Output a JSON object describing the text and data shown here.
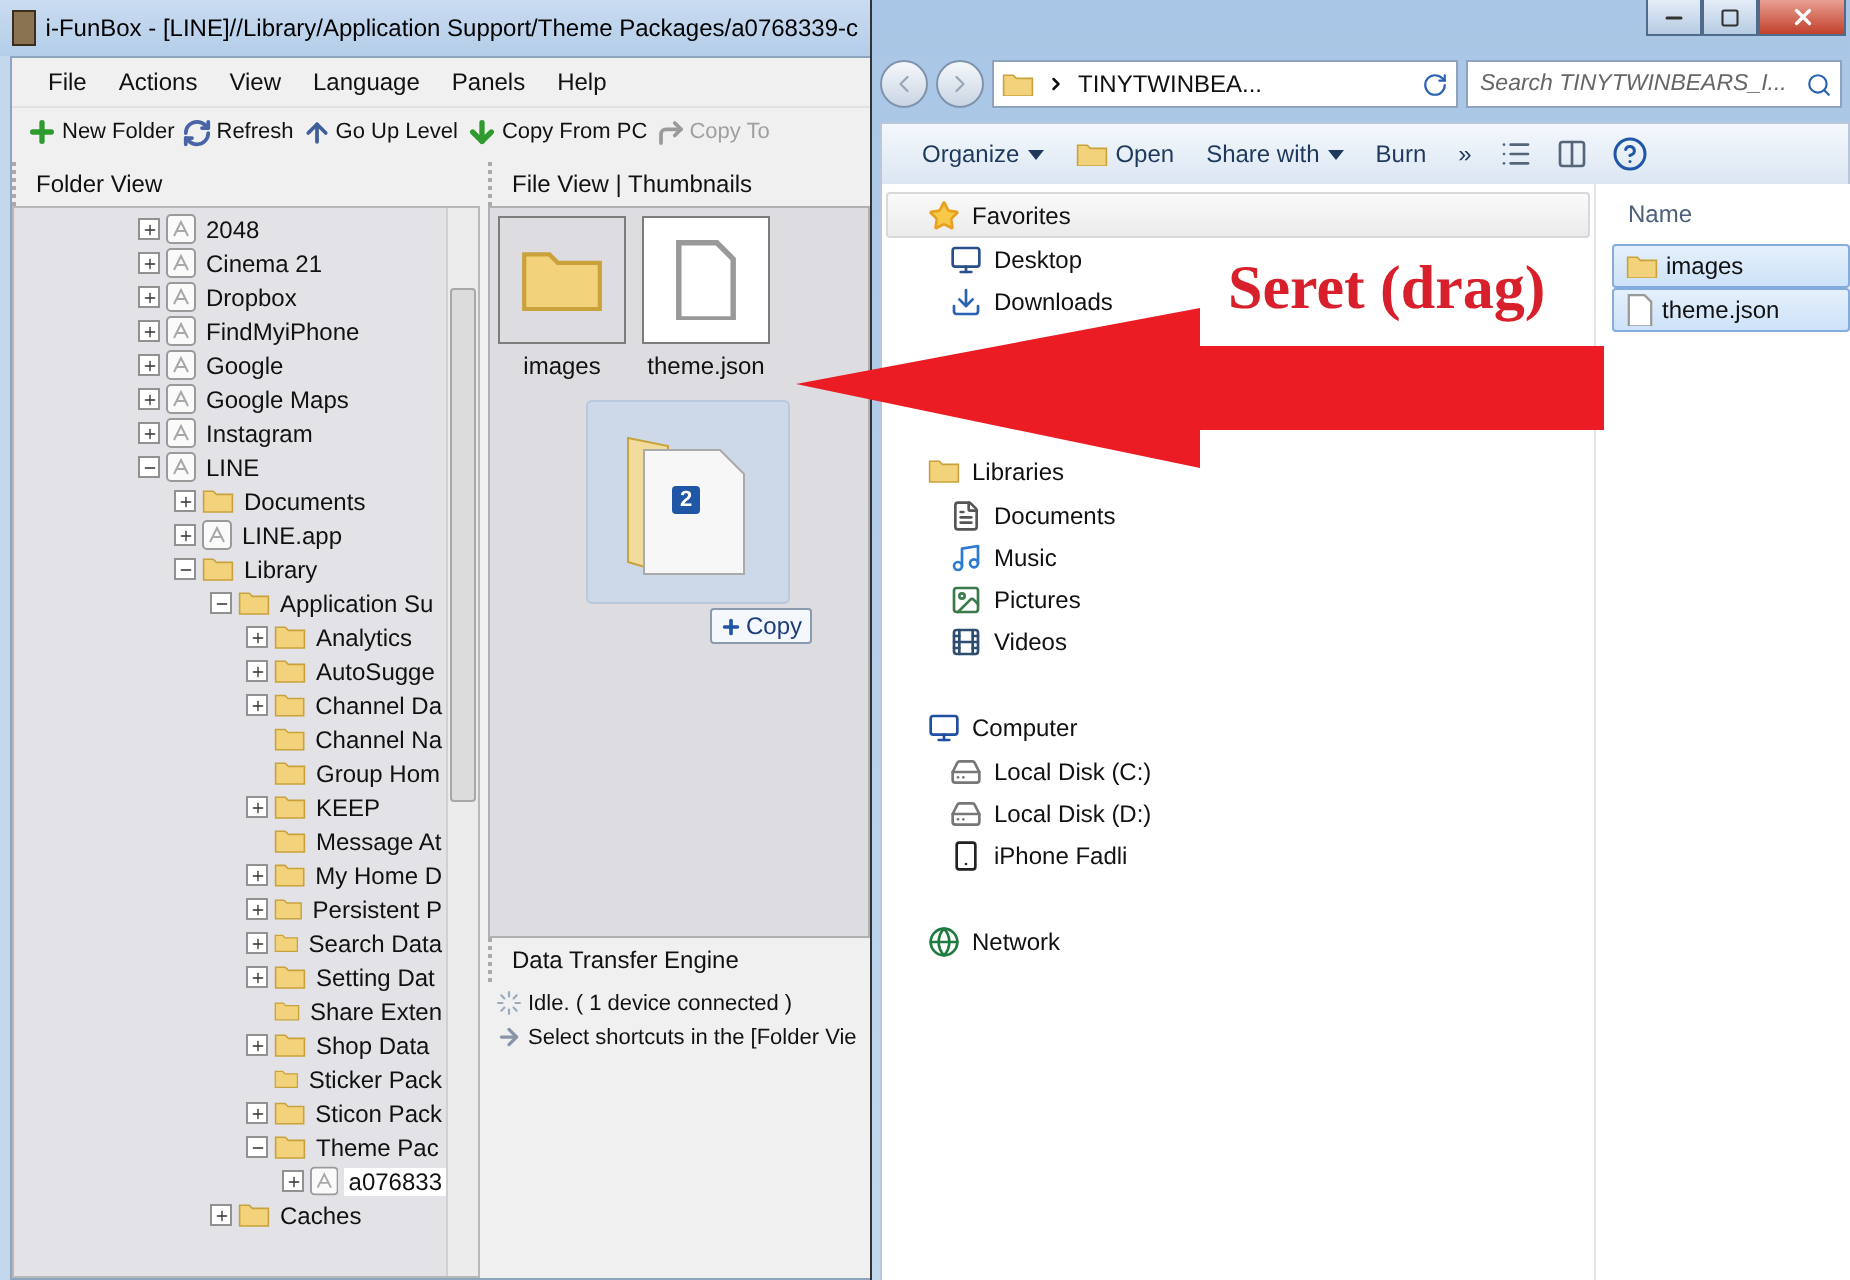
{
  "left_window": {
    "title": "i-FunBox - [LINE]//Library/Application Support/Theme Packages/a0768339-c",
    "menu": [
      "File",
      "Actions",
      "View",
      "Language",
      "Panels",
      "Help"
    ],
    "toolbar": [
      {
        "label": "New Folder",
        "kind": "new-folder",
        "disabled": false
      },
      {
        "label": "Refresh",
        "kind": "refresh",
        "disabled": false
      },
      {
        "label": "Go Up Level",
        "kind": "up",
        "disabled": false
      },
      {
        "label": "Copy From PC",
        "kind": "copy-from",
        "disabled": false
      },
      {
        "label": "Copy To",
        "kind": "copy-to",
        "disabled": true
      }
    ],
    "folder_view": {
      "title": "Folder View",
      "tree": [
        {
          "label": "2048",
          "kind": "app",
          "expanded": false,
          "selected": false
        },
        {
          "label": "Cinema 21",
          "kind": "app",
          "expanded": false,
          "selected": false
        },
        {
          "label": "Dropbox",
          "kind": "app",
          "expanded": false,
          "selected": false
        },
        {
          "label": "FindMyiPhone",
          "kind": "app",
          "expanded": false,
          "selected": false
        },
        {
          "label": "Google",
          "kind": "app",
          "expanded": false,
          "selected": false
        },
        {
          "label": "Google Maps",
          "kind": "app",
          "expanded": false,
          "selected": false
        },
        {
          "label": "Instagram",
          "kind": "app",
          "expanded": false,
          "selected": false
        },
        {
          "label": "LINE",
          "kind": "app",
          "expanded": true,
          "selected": false,
          "children": [
            {
              "label": "Documents",
              "kind": "folder",
              "expanded": false,
              "selected": false
            },
            {
              "label": "LINE.app",
              "kind": "app",
              "expanded": false,
              "selected": false
            },
            {
              "label": "Library",
              "kind": "folder",
              "expanded": true,
              "selected": false,
              "children": [
                {
                  "label": "Application Su",
                  "kind": "folder",
                  "expanded": true,
                  "selected": false,
                  "children": [
                    {
                      "label": "Analytics",
                      "kind": "folder",
                      "expanded": false,
                      "selected": false
                    },
                    {
                      "label": "AutoSugge",
                      "kind": "folder",
                      "expanded": false,
                      "selected": false
                    },
                    {
                      "label": "Channel Da",
                      "kind": "folder",
                      "expanded": false,
                      "selected": false
                    },
                    {
                      "label": "Channel Na",
                      "kind": "folder",
                      "selected": false
                    },
                    {
                      "label": "Group Hom",
                      "kind": "folder",
                      "selected": false
                    },
                    {
                      "label": "KEEP",
                      "kind": "folder",
                      "expanded": false,
                      "selected": false
                    },
                    {
                      "label": "Message At",
                      "kind": "folder",
                      "selected": false
                    },
                    {
                      "label": "My Home D",
                      "kind": "folder",
                      "expanded": false,
                      "selected": false
                    },
                    {
                      "label": "Persistent P",
                      "kind": "folder",
                      "expanded": false,
                      "selected": false
                    },
                    {
                      "label": "Search Data",
                      "kind": "folder",
                      "expanded": false,
                      "selected": false
                    },
                    {
                      "label": "Setting Dat",
                      "kind": "folder",
                      "expanded": false,
                      "selected": false
                    },
                    {
                      "label": "Share Exten",
                      "kind": "folder",
                      "selected": false
                    },
                    {
                      "label": "Shop Data",
                      "kind": "folder",
                      "expanded": false,
                      "selected": false
                    },
                    {
                      "label": "Sticker Pack",
                      "kind": "folder",
                      "selected": false
                    },
                    {
                      "label": "Sticon Pack",
                      "kind": "folder",
                      "expanded": false,
                      "selected": false
                    },
                    {
                      "label": "Theme Pac",
                      "kind": "folder",
                      "expanded": true,
                      "selected": false,
                      "children": [
                        {
                          "label": "a076833",
                          "kind": "app",
                          "expanded": false,
                          "selected": true
                        }
                      ]
                    }
                  ]
                },
                {
                  "label": "Caches",
                  "kind": "folder",
                  "expanded": false,
                  "selected": false
                }
              ]
            }
          ]
        }
      ]
    },
    "file_view": {
      "title": "File View | Thumbnails",
      "items": [
        {
          "name": "images",
          "kind": "folder",
          "selected": true
        },
        {
          "name": "theme.json",
          "kind": "file",
          "selected": true
        }
      ],
      "drag": {
        "count": "2",
        "action": "Copy"
      }
    },
    "transfer": {
      "title": "Data Transfer Engine",
      "lines": [
        {
          "kind": "idle",
          "text": "Idle. ( 1 device connected )"
        },
        {
          "kind": "hint",
          "text": "Select shortcuts in the [Folder Vie"
        }
      ]
    }
  },
  "right_window": {
    "address": "TINYTWINBEA...",
    "search": {
      "placeholder": "Search TINYTWINBEARS_I..."
    },
    "toolbar": [
      {
        "label": "Organize",
        "kind": "menu"
      },
      {
        "label": "Open",
        "kind": "open"
      },
      {
        "label": "Share with",
        "kind": "menu"
      },
      {
        "label": "Burn",
        "kind": "plain"
      },
      {
        "label": "»",
        "kind": "more"
      }
    ],
    "nav": [
      {
        "label": "Favorites",
        "kind": "favorites",
        "children": [
          {
            "label": "Desktop",
            "kind": "desktop"
          },
          {
            "label": "Downloads",
            "kind": "downloads"
          }
        ]
      },
      {
        "label": "Libraries",
        "kind": "libraries",
        "children": [
          {
            "label": "Documents",
            "kind": "documents"
          },
          {
            "label": "Music",
            "kind": "music"
          },
          {
            "label": "Pictures",
            "kind": "pictures"
          },
          {
            "label": "Videos",
            "kind": "videos"
          }
        ]
      },
      {
        "label": "Computer",
        "kind": "computer",
        "children": [
          {
            "label": "Local Disk (C:)",
            "kind": "disk"
          },
          {
            "label": "Local Disk (D:)",
            "kind": "disk"
          },
          {
            "label": "iPhone Fadli",
            "kind": "phone"
          }
        ]
      },
      {
        "label": "Network",
        "kind": "network"
      }
    ],
    "column": "Name",
    "files": [
      {
        "name": "images",
        "kind": "folder",
        "selected": true
      },
      {
        "name": "theme.json",
        "kind": "file",
        "selected": true
      }
    ]
  },
  "annotation": {
    "text": "Seret (drag)"
  }
}
